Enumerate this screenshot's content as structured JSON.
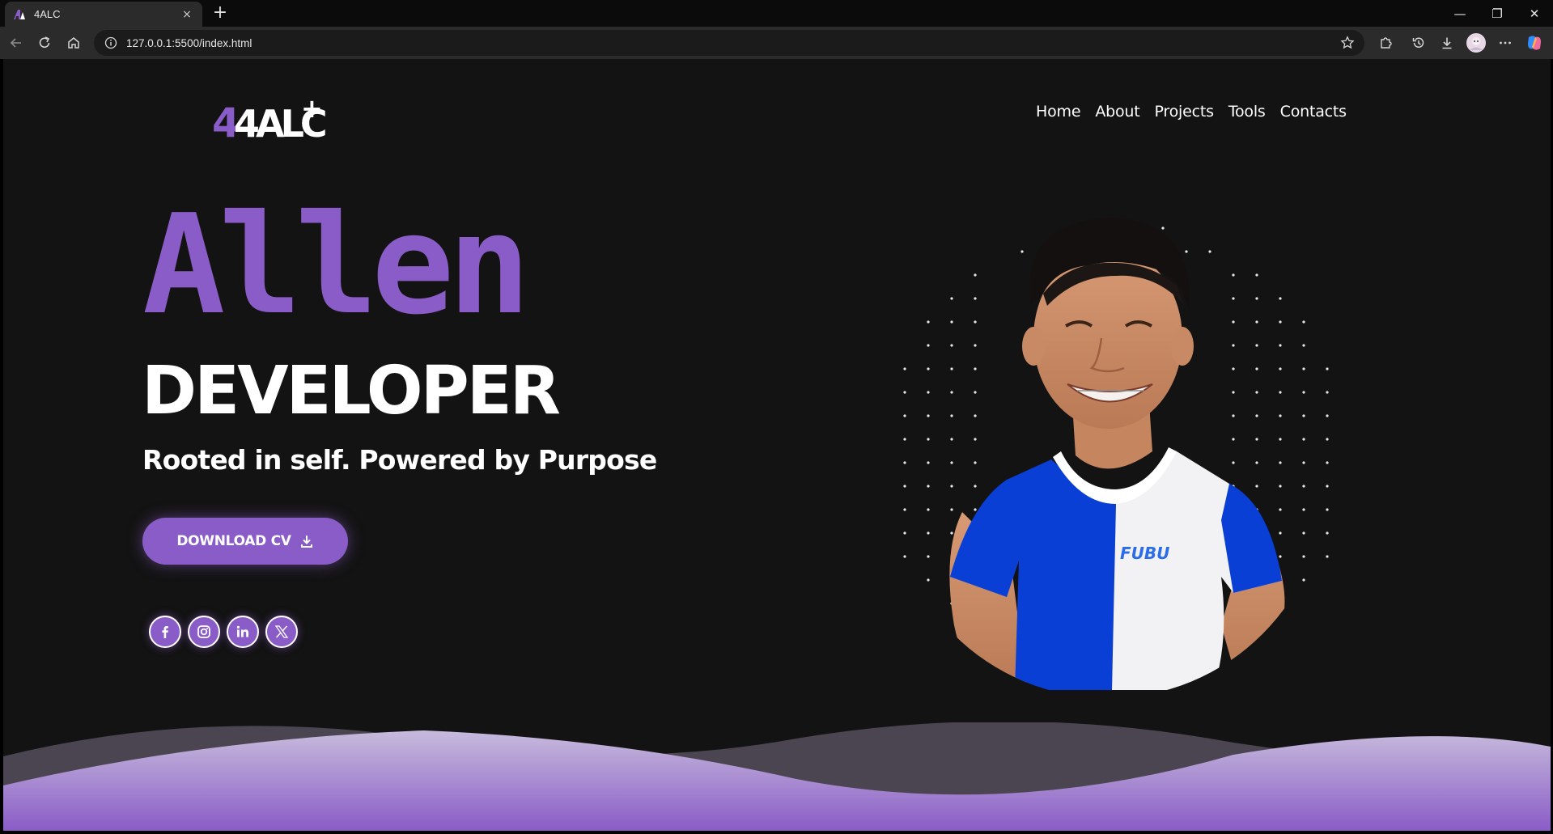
{
  "browser": {
    "tab_title": "4ALC",
    "tab_close": "×",
    "new_tab": "+",
    "url": "127.0.0.1:5500/index.html",
    "window_controls": {
      "minimize": "—",
      "restore": "❐",
      "close": "✕"
    }
  },
  "site": {
    "logo_text": "4ALC",
    "logo_plus": "+",
    "nav": [
      "Home",
      "About",
      "Projects",
      "Tools",
      "Contacts"
    ],
    "hero": {
      "name": "Allen",
      "role": "DEVELOPER",
      "tagline": "Rooted in self. Powered by Purpose",
      "cta_label": "DOWNLOAD CV"
    },
    "shirt_print": "FUBU",
    "socials": [
      "facebook-icon",
      "instagram-icon",
      "linkedin-icon",
      "x-twitter-icon"
    ]
  },
  "colors": {
    "accent": "#8a5cc7",
    "background": "#131313",
    "wave_light": "#b7a8d6",
    "wave_dark": "#4a4550",
    "shirt_blue": "#0a3fd6"
  }
}
